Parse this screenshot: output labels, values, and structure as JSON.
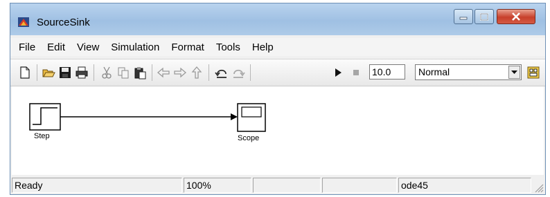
{
  "window": {
    "title": "SourceSink"
  },
  "menu": {
    "items": [
      "File",
      "Edit",
      "View",
      "Simulation",
      "Format",
      "Tools",
      "Help"
    ]
  },
  "toolbar": {
    "icons": [
      "new-icon",
      "open-icon",
      "save-icon",
      "print-icon",
      "cut-icon",
      "copy-icon",
      "paste-icon",
      "back-icon",
      "forward-icon",
      "up-icon",
      "undo-icon",
      "redo-icon",
      "start-icon",
      "stop-icon",
      "library-browser-icon"
    ],
    "stop_time": "10.0",
    "sim_mode": "Normal"
  },
  "canvas": {
    "blocks": [
      {
        "name": "Step"
      },
      {
        "name": "Scope"
      }
    ]
  },
  "status": {
    "state": "Ready",
    "zoom": "100%",
    "cell3": "",
    "cell4": "",
    "solver": "ode45"
  }
}
